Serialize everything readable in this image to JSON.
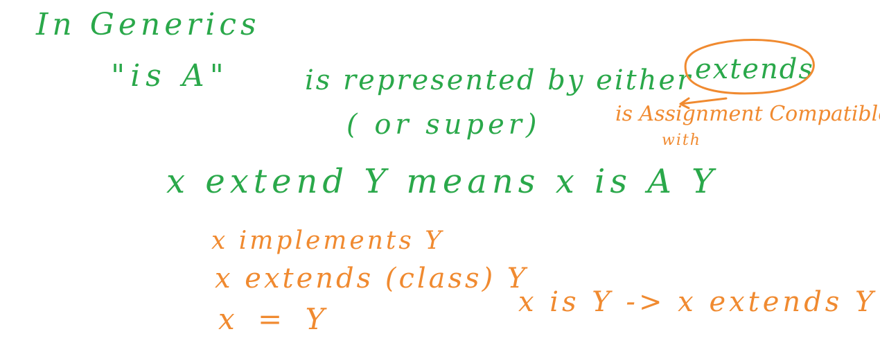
{
  "colors": {
    "green_ink": "#2aa84a",
    "orange_ink": "#f08a30",
    "background": "#ffffff"
  },
  "notes": {
    "title": "In Generics",
    "is_a_quoted": "\"is A\"",
    "represented_line": "is represented by either",
    "extends_circled": "extends",
    "or_super": "( or super)",
    "assignment_note": "is Assignment Compatible",
    "assignment_note_with": "with",
    "x_extend_y": "x extend Y means x is A Y",
    "implements_line": "x implements Y",
    "extends_class_line": "x extends (class) Y",
    "equals_line": "x = Y",
    "arrow_line": "x is Y -> x extends Y"
  }
}
